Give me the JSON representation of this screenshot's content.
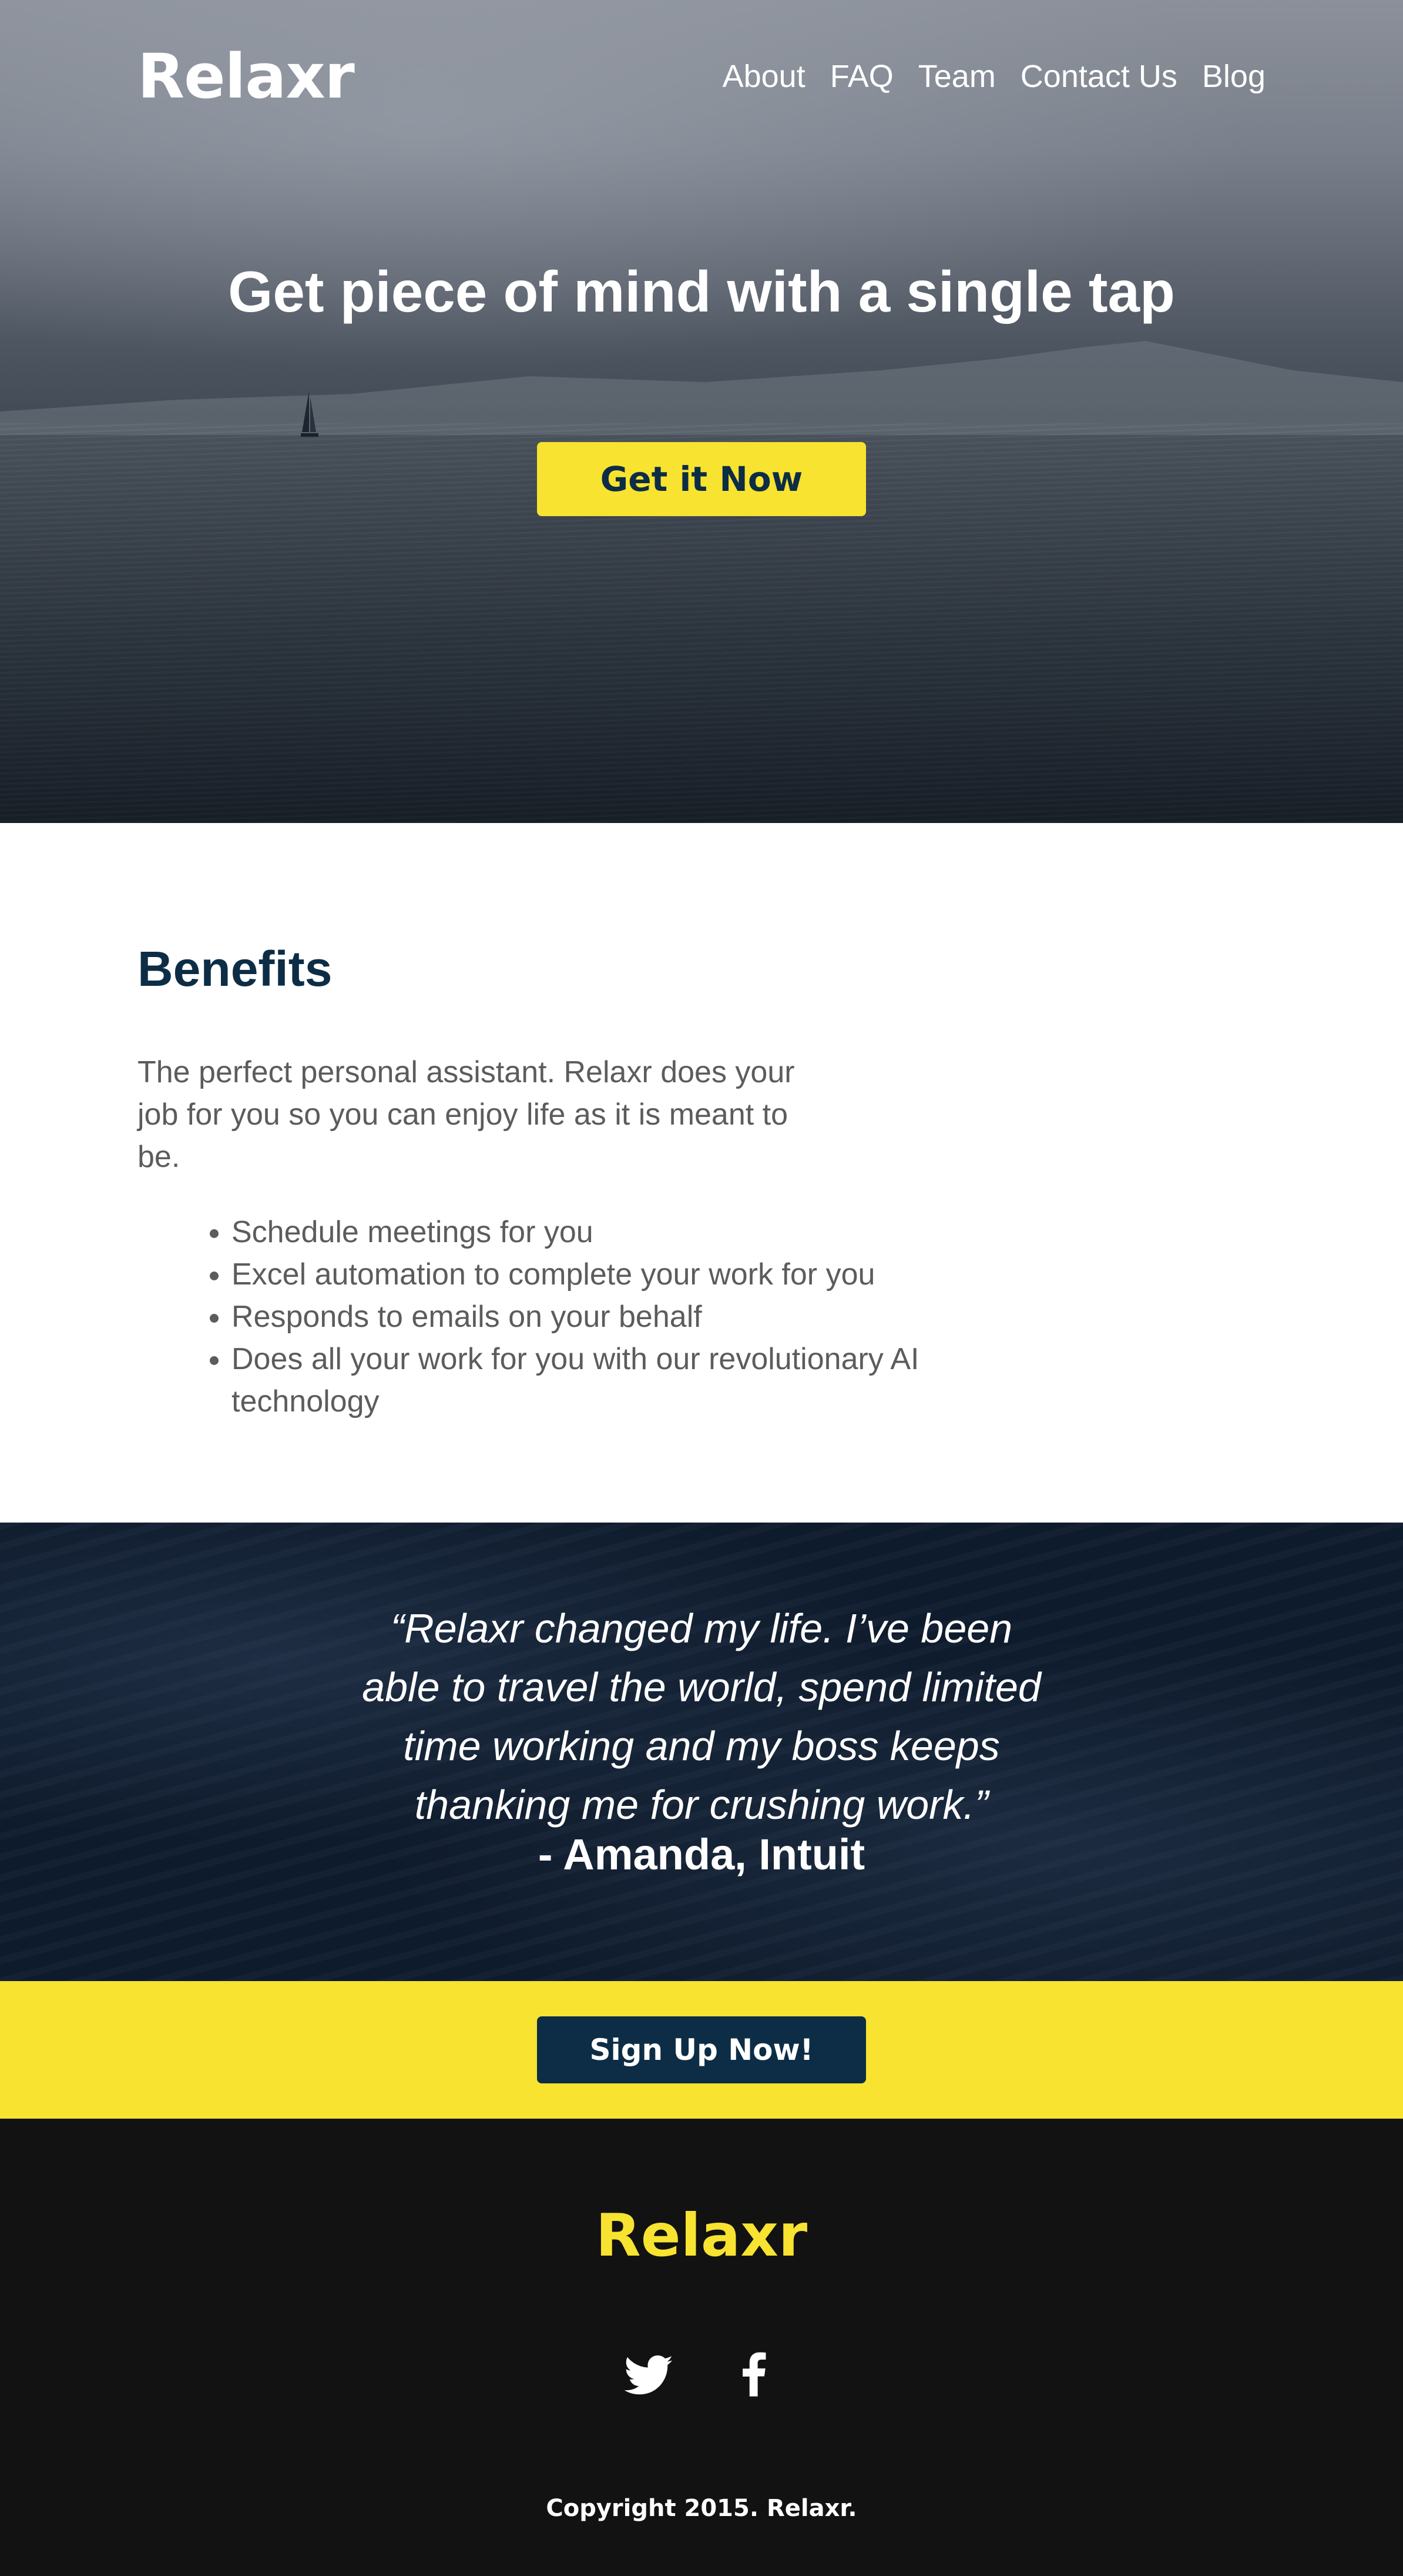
{
  "header": {
    "logo": "Relaxr",
    "nav": [
      {
        "label": "About"
      },
      {
        "label": "FAQ"
      },
      {
        "label": "Team"
      },
      {
        "label": "Contact Us"
      },
      {
        "label": "Blog"
      }
    ]
  },
  "hero": {
    "title": "Get piece of mind with a single tap",
    "cta_label": "Get it Now"
  },
  "benefits": {
    "heading": "Benefits",
    "description": "The perfect personal assistant. Relaxr does your job for you so you can enjoy life as it is meant to be.",
    "items": [
      "Schedule meetings for you",
      "Excel automation to complete your work for you",
      "Responds to emails on your behalf",
      "Does all your work for you with our revolutionary AI technology"
    ]
  },
  "testimonial": {
    "quote": "“Relaxr changed my life. I’ve been able to travel the world, spend limited time working and my boss keeps thanking me for crushing work.”",
    "author": "- Amanda, Intuit"
  },
  "signup": {
    "button_label": "Sign Up Now!"
  },
  "footer": {
    "logo": "Relaxr",
    "social": [
      {
        "icon": "twitter-icon"
      },
      {
        "icon": "facebook-icon"
      }
    ],
    "copyright": "Copyright 2015. Relaxr."
  },
  "colors": {
    "accent_yellow": "#f7e330",
    "navy": "#0c2d45",
    "footer_bg": "#121212",
    "body_text": "#5c5c5c"
  }
}
